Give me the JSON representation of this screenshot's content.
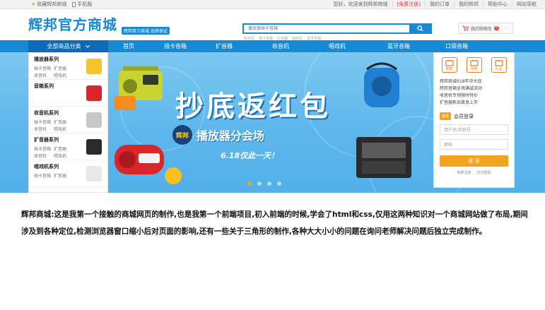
{
  "topbar": {
    "favorite_label": "收藏辉邦商城",
    "mobile_label": "手机版",
    "links": [
      "您好，欢迎来到辉邦商城",
      "[免费注册]",
      "我的订单",
      "我的辉邦",
      "帮助中心",
      "网站导航"
    ]
  },
  "header": {
    "logo_text": "辉邦官方商城",
    "slogan": "辉邦官方商城 品质保证",
    "search_placeholder": "播放器插卡音箱",
    "hot_words": [
      "收音机",
      "插卡音箱",
      "扩音器",
      "唱戏机",
      "蓝牙音箱"
    ],
    "cart_label": "我的购物车",
    "cart_count": "0"
  },
  "nav": {
    "all_categories": "全部商品分类",
    "items": [
      "首页",
      "插卡音箱",
      "扩音器",
      "收音机",
      "唱戏机",
      "蓝牙音箱",
      "口袋音箱"
    ]
  },
  "sidebar": {
    "categories": [
      {
        "title": "播放器系列",
        "subs": [
          "插卡音箱",
          "扩音器",
          "收音机",
          "唱戏机"
        ]
      },
      {
        "title": "音箱系列"
      },
      {
        "title": "收音机系列",
        "subs": [
          "插卡音箱",
          "扩音器",
          "收音机",
          "唱戏机"
        ]
      },
      {
        "title": "扩音器系列",
        "subs": [
          "插卡音箱",
          "扩音器",
          "收音机",
          "唱戏机"
        ]
      },
      {
        "title": "唱戏机系列",
        "subs": [
          "插卡音箱",
          "扩音器"
        ]
      }
    ]
  },
  "banner": {
    "headline": "抄底返红包",
    "seal": "辉邦",
    "subtitle": "播放器分会场",
    "date": "6.18仅此一天！"
  },
  "panel": {
    "shortcuts": [
      "签到",
      "领券",
      "礼品"
    ],
    "news": [
      "辉邦商城618年中大促",
      "辉邦音箱全场满减活动",
      "收音机专场限时特价",
      "扩音器新品首发上市"
    ],
    "login_badge": "会员",
    "login_label": "会员登录",
    "username_placeholder": "用户名/手机号",
    "password_placeholder": "密码",
    "login_button": "登 录",
    "links": [
      "免费注册",
      "忘记密码"
    ]
  },
  "caption": "辉邦商城:这是我第一个接触的商城网页的制作,也是我第一个前端项目,初入前端的时候,学会了html和css,仅用这两种知识对一个商城网站做了布局,期间涉及到各种定位,检测浏览器窗口缩小后对页面的影响,还有一些关于三角形的制作,各种大大小小的问题在询问老师解决问题后独立完成制作。",
  "colors": {
    "brand": "#1689d7",
    "accent": "#f4a31c",
    "red": "#e4393c"
  }
}
